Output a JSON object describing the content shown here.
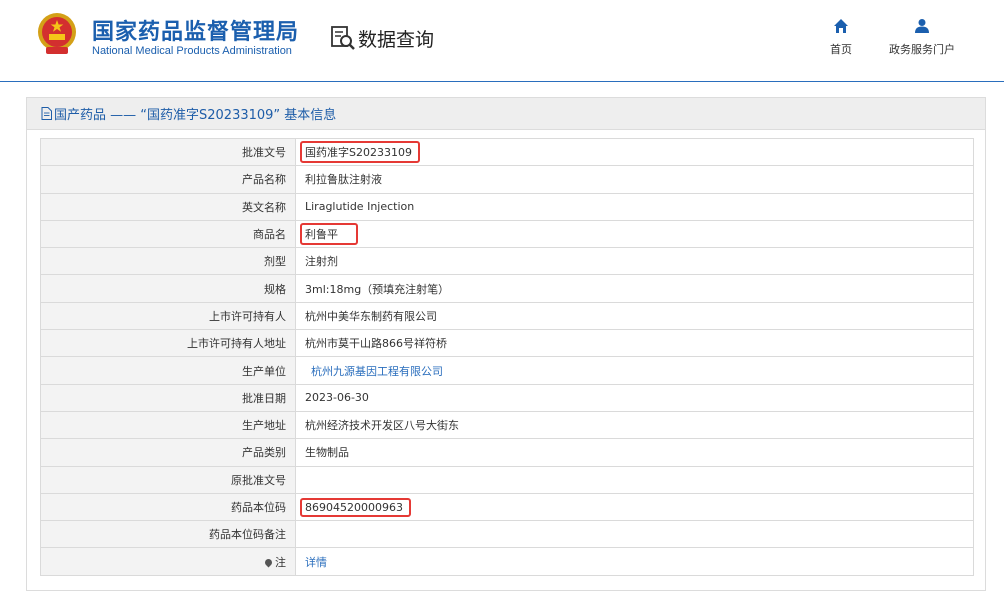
{
  "header": {
    "brand_cn": "国家药品监督管理局",
    "brand_en": "National Medical Products Administration",
    "query_label": "数据查询",
    "nav": [
      {
        "label": "首页",
        "icon": "home-icon"
      },
      {
        "label": "政务服务门户",
        "icon": "user-icon"
      }
    ]
  },
  "panel": {
    "title": "国产药品 —— “国药准字S20233109” 基本信息"
  },
  "rows": [
    {
      "key": "批准文号",
      "value": "国药准字S20233109"
    },
    {
      "key": "产品名称",
      "value": "利拉鲁肽注射液"
    },
    {
      "key": "英文名称",
      "value": "Liraglutide Injection"
    },
    {
      "key": "商品名",
      "value": "利鲁平"
    },
    {
      "key": "剂型",
      "value": "注射剂"
    },
    {
      "key": "规格",
      "value": "3ml:18mg（预填充注射笔）"
    },
    {
      "key": "上市许可持有人",
      "value": "杭州中美华东制药有限公司"
    },
    {
      "key": "上市许可持有人地址",
      "value": "杭州市莫干山路866号祥符桥"
    },
    {
      "key": "生产单位",
      "value": "杭州九源基因工程有限公司"
    },
    {
      "key": "批准日期",
      "value": "2023-06-30"
    },
    {
      "key": "生产地址",
      "value": "杭州经济技术开发区八号大街东"
    },
    {
      "key": "产品类别",
      "value": "生物制品"
    },
    {
      "key": "原批准文号",
      "value": ""
    },
    {
      "key": "药品本位码",
      "value": "86904520000963"
    },
    {
      "key": "药品本位码备注",
      "value": ""
    },
    {
      "key": "注",
      "value": "详情"
    }
  ],
  "colors": {
    "brand_blue": "#1b5fae",
    "link_blue": "#2a6ebd",
    "highlight_red": "#e53935"
  }
}
